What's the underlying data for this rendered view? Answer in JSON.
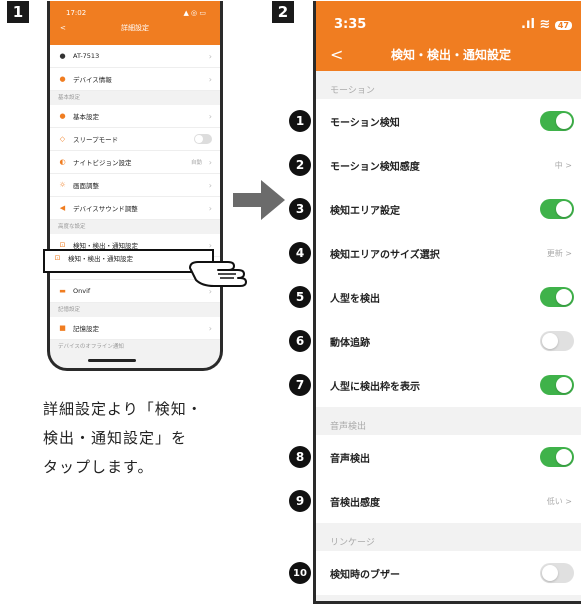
{
  "steps": {
    "one": "1",
    "two": "2"
  },
  "phone1": {
    "status": {
      "time": "17:02",
      "signal": "▲ ◎ ▭"
    },
    "header": {
      "back": "<",
      "title": "詳細設定"
    },
    "rows": [
      {
        "type": "item",
        "icon": "●",
        "label": "AT-7513"
      },
      {
        "type": "item",
        "icon": "●",
        "label": "デバイス情報"
      },
      {
        "type": "section",
        "label": "基本設定"
      },
      {
        "type": "item",
        "icon": "●",
        "label": "基本設定"
      },
      {
        "type": "switch",
        "icon": "◇",
        "label": "スリープモード"
      },
      {
        "type": "item",
        "icon": "◐",
        "label": "ナイトビジョン設定",
        "value": "自動"
      },
      {
        "type": "item",
        "icon": "☼",
        "label": "画面調整"
      },
      {
        "type": "item",
        "icon": "◀",
        "label": "デバイスサウンド調整"
      },
      {
        "type": "section",
        "label": "高度な設定"
      },
      {
        "type": "item",
        "icon": "⊡",
        "label": "検知・検出・通知設定"
      },
      {
        "type": "item",
        "icon": "✱",
        "label": "ブザー調整"
      },
      {
        "type": "item",
        "icon": "▬",
        "label": "Onvif"
      },
      {
        "type": "section",
        "label": "記憶設定"
      },
      {
        "type": "item",
        "icon": "■",
        "label": "記憶設定"
      },
      {
        "type": "section",
        "label": "デバイスのオフライン通知"
      }
    ]
  },
  "phone2": {
    "status": {
      "time": "3:35",
      "signal": ".ıl ≋",
      "battery": "47"
    },
    "header": {
      "back": "<",
      "title": "検知・検出・通知設定"
    },
    "sections": [
      {
        "label": "モーション",
        "rows": [
          {
            "num": "1",
            "label": "モーション検知",
            "control": "on"
          },
          {
            "num": "2",
            "label": "モーション検知感度",
            "value": "中 >"
          },
          {
            "num": "3",
            "label": "検知エリア設定",
            "control": "on"
          },
          {
            "num": "4",
            "label": "検知エリアのサイズ選択",
            "value": "更新 >"
          },
          {
            "num": "5",
            "label": "人型を検出",
            "control": "on"
          },
          {
            "num": "6",
            "label": "動体追跡",
            "control": "off"
          },
          {
            "num": "7",
            "label": "人型に検出枠を表示",
            "control": "on"
          }
        ]
      },
      {
        "label": "音声検出",
        "rows": [
          {
            "num": "8",
            "label": "音声検出",
            "control": "on"
          },
          {
            "num": "9",
            "label": "音検出感度",
            "value": "低い >"
          }
        ]
      },
      {
        "label": "リンケージ",
        "rows": [
          {
            "num": "10",
            "label": "検知時のブザー",
            "control": "off"
          }
        ]
      }
    ]
  },
  "description": {
    "line1": "詳細設定より「検知・",
    "line2": "検出・通知設定」を",
    "line3": "タップします。"
  },
  "colors": {
    "accent": "#f07d21",
    "toggle_on": "#3fb24a"
  }
}
